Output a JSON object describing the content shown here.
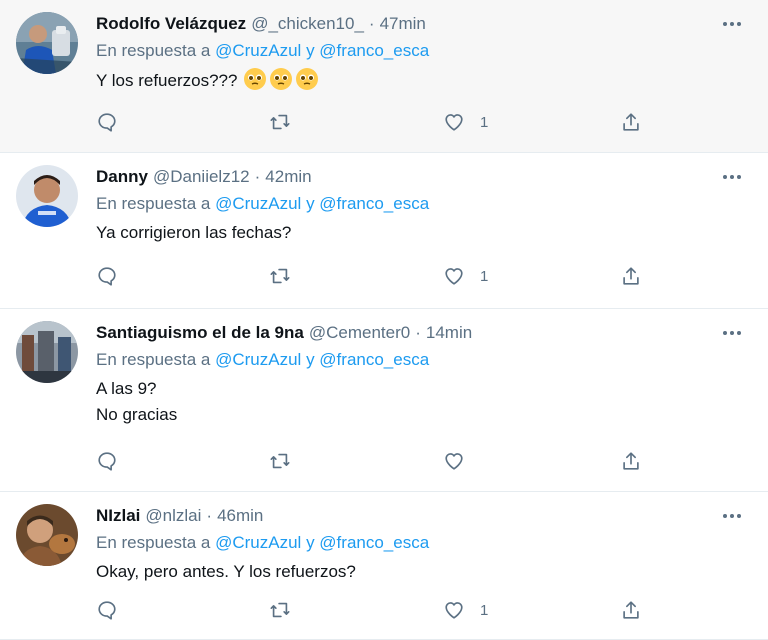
{
  "tweets": [
    {
      "name": "Rodolfo Velázquez",
      "handle": "@_chicken10_",
      "dot": "·",
      "time": "47min",
      "reply_prefix": "En respuesta a",
      "reply_user1": "@CruzAzul",
      "reply_join": "y",
      "reply_user2": "@franco_esca",
      "text_lines": [
        "Y los refuerzos???"
      ],
      "emojis": [
        "pleading-face-emoji",
        "pleading-face-emoji",
        "pleading-face-emoji"
      ],
      "likes": "1",
      "avatar": "avatar-soccer-player-blue"
    },
    {
      "name": "Danny",
      "handle": "@Daniielz12",
      "dot": "·",
      "time": "42min",
      "reply_prefix": "En respuesta a",
      "reply_user1": "@CruzAzul",
      "reply_join": "y",
      "reply_user2": "@franco_esca",
      "text_lines": [
        "Ya corrigieron las fechas?"
      ],
      "likes": "1",
      "avatar": "avatar-man-blue-jersey"
    },
    {
      "name": "Santiaguismo el de la 9na",
      "handle": "@Cementer0",
      "dot": "·",
      "time": "14min",
      "reply_prefix": "En respuesta a",
      "reply_user1": "@CruzAzul",
      "reply_join": "y",
      "reply_user2": "@franco_esca",
      "text_lines": [
        "A las 9?",
        "No gracias"
      ],
      "likes": "",
      "avatar": "avatar-stadium"
    },
    {
      "name": "NIzlai",
      "handle": "@nlzlai",
      "dot": "·",
      "time": "46min",
      "reply_prefix": "En respuesta a",
      "reply_user1": "@CruzAzul",
      "reply_join": "y",
      "reply_user2": "@franco_esca",
      "text_lines": [
        "Okay, pero antes. Y los refuerzos?"
      ],
      "likes": "1",
      "avatar": "avatar-man-with-dog"
    }
  ],
  "icons": {
    "more": "more-horizontal-icon",
    "reply": "reply-icon",
    "retweet": "retweet-icon",
    "like": "heart-icon",
    "share": "share-icon"
  },
  "colors": {
    "link": "#1d9bf0",
    "secondary_text": "#5b7083",
    "hover_background": "#f7f7f7",
    "divider": "#e6ecf0"
  }
}
